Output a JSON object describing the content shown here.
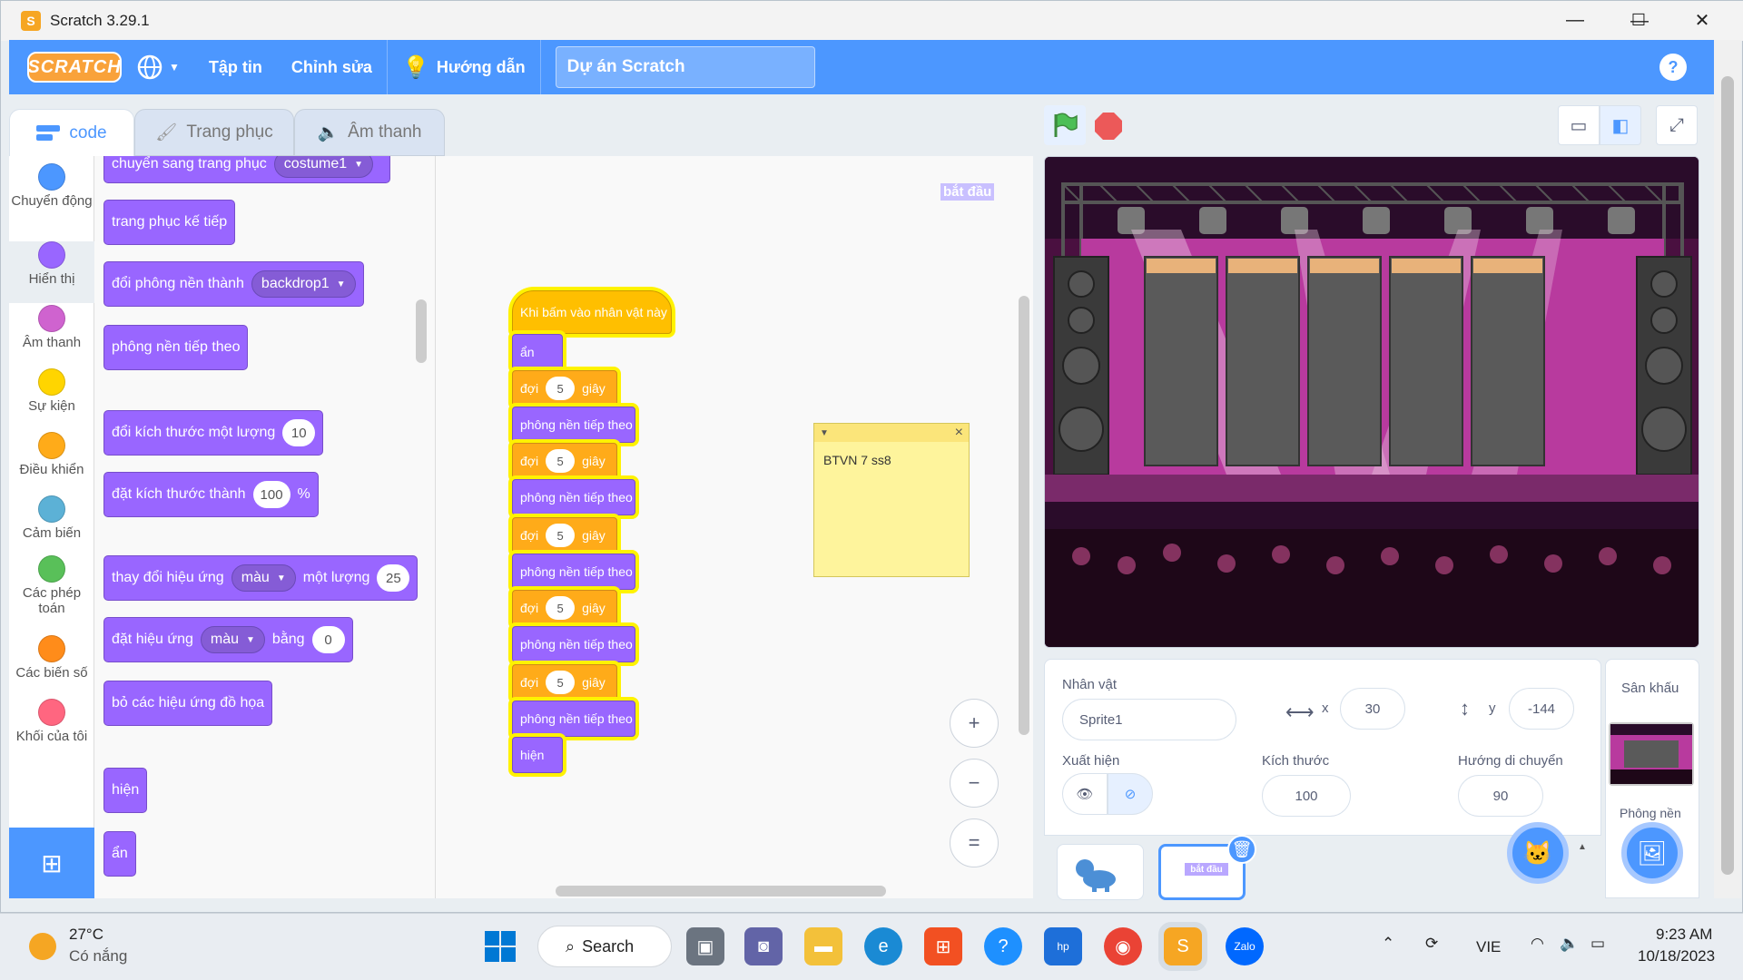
{
  "window": {
    "title": "Scratch 3.29.1",
    "minimize": "—",
    "maximize": "☐",
    "close": "✕"
  },
  "menubar": {
    "logo": "SCRATCH",
    "file": "Tập tin",
    "edit": "Chỉnh sửa",
    "tutorials": "Hướng dẫn",
    "project_title": "Dự án Scratch",
    "help": "?"
  },
  "tabs": {
    "code": "code",
    "costumes": "Trang phục",
    "sounds": "Âm thanh"
  },
  "categories": [
    {
      "label": "Chuyển động",
      "color": "#4c97ff"
    },
    {
      "label": "Hiển thị",
      "color": "#9966ff"
    },
    {
      "label": "Âm thanh",
      "color": "#cf63cf"
    },
    {
      "label": "Sự kiện",
      "color": "#ffd500"
    },
    {
      "label": "Điều khiển",
      "color": "#ffab19"
    },
    {
      "label": "Cảm biến",
      "color": "#5cb1d6"
    },
    {
      "label": "Các phép toán",
      "color": "#59c059"
    },
    {
      "label": "Các biến số",
      "color": "#ff8c1a"
    },
    {
      "label": "Khối của tôi",
      "color": "#ff6680"
    }
  ],
  "palette": {
    "switch_costume": "chuyển sang trang phục",
    "costume_value": "costume1",
    "next_costume": "trang phục kế tiếp",
    "switch_backdrop": "đổi phông nền thành",
    "backdrop_value": "backdrop1",
    "next_backdrop": "phông nền tiếp theo",
    "change_size": "đổi kích thước một lượng",
    "change_size_value": "10",
    "set_size": "đặt kích thước thành",
    "set_size_value": "100",
    "set_size_unit": "%",
    "change_effect": "thay đổi hiệu ứng",
    "effect_color": "màu",
    "change_effect_by": "một lượng",
    "change_effect_value": "25",
    "set_effect": "đặt hiệu ứng",
    "set_effect_to": "bằng",
    "set_effect_value": "0",
    "clear_effects": "bỏ các hiệu ứng đồ họa",
    "show": "hiện",
    "hide": "ẩn"
  },
  "script": {
    "hat": "Khi bấm vào nhân vật này",
    "hide": "ẩn",
    "wait": "đợi",
    "wait_value": "5",
    "wait_unit": "giây",
    "next_backdrop": "phông nền tiếp theo",
    "show": "hiện"
  },
  "workspace": {
    "sprite_label": "bắt đầu",
    "note_text": "BTVN 7 ss8",
    "note_close": "×",
    "zoom_in": "+",
    "zoom_out": "−",
    "zoom_reset": "="
  },
  "sprite": {
    "sprite_label": "Nhân vật",
    "name": "Sprite1",
    "x_label": "x",
    "x": "30",
    "y_label": "y",
    "y": "-144",
    "show_label": "Xuất hiện",
    "size_label": "Kích thước",
    "size": "100",
    "direction_label": "Hướng di chuyển",
    "direction": "90",
    "thumb2_label": "bắt đầu"
  },
  "stage_pane": {
    "title": "Sân khấu",
    "backdrops_label": "Phông nền"
  },
  "taskbar": {
    "temp": "27°C",
    "weather": "Có nắng",
    "search": "Search",
    "lang": "VIE",
    "time": "9:23 AM",
    "date": "10/18/2023"
  }
}
